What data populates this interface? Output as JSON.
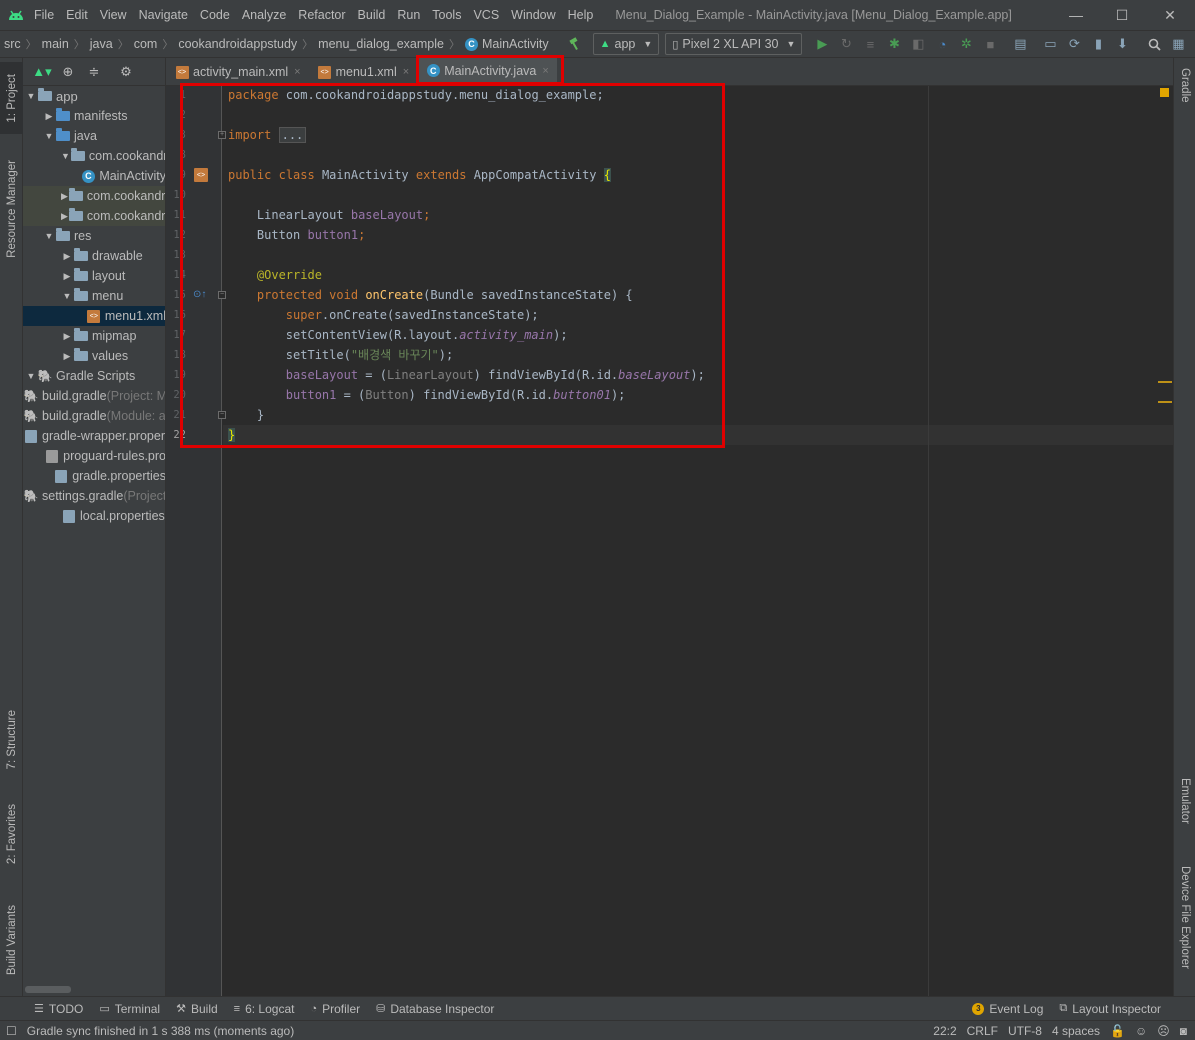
{
  "menubar": {
    "items": [
      "File",
      "Edit",
      "View",
      "Navigate",
      "Code",
      "Analyze",
      "Refactor",
      "Build",
      "Run",
      "Tools",
      "VCS",
      "Window",
      "Help"
    ],
    "window_title": "Menu_Dialog_Example - MainActivity.java [Menu_Dialog_Example.app]",
    "minimize": "—",
    "maximize": "☐",
    "close": "✕"
  },
  "navbar": {
    "breadcrumbs": [
      "src",
      "main",
      "java",
      "com",
      "cookandroidappstudy",
      "menu_dialog_example",
      "MainActivity"
    ],
    "run_config": "app",
    "device": "Pixel 2 XL API 30"
  },
  "left_tabs": [
    "1: Project",
    "Resource Manager",
    "7: Structure",
    "2: Favorites",
    "Build Variants"
  ],
  "right_tabs": [
    "Gradle",
    "Emulator",
    "Device File Explorer"
  ],
  "project_tree": [
    {
      "label": "app",
      "muted": ""
    },
    {
      "label": "manifests",
      "muted": ""
    },
    {
      "label": "java",
      "muted": ""
    },
    {
      "label": "com.cookandroidappstudy.menu_dialog_example",
      "muted": ""
    },
    {
      "label": "MainActivity",
      "muted": ""
    },
    {
      "label": "com.cookandroidappstudy.menu_dialog_example",
      "muted": ""
    },
    {
      "label": "com.cookandroidappstudy.menu_dialog_example",
      "muted": ""
    },
    {
      "label": "res",
      "muted": ""
    },
    {
      "label": "drawable",
      "muted": ""
    },
    {
      "label": "layout",
      "muted": ""
    },
    {
      "label": "menu",
      "muted": ""
    },
    {
      "label": "menu1.xml",
      "muted": ""
    },
    {
      "label": "mipmap",
      "muted": ""
    },
    {
      "label": "values",
      "muted": ""
    },
    {
      "label": "Gradle Scripts",
      "muted": ""
    },
    {
      "label": "build.gradle",
      "muted": " (Project: Menu_Dialog_Example)"
    },
    {
      "label": "build.gradle",
      "muted": " (Module: app)"
    },
    {
      "label": "gradle-wrapper.properties",
      "muted": ""
    },
    {
      "label": "proguard-rules.pro",
      "muted": ""
    },
    {
      "label": "gradle.properties",
      "muted": ""
    },
    {
      "label": "settings.gradle",
      "muted": " (Project Settings)"
    },
    {
      "label": "local.properties",
      "muted": ""
    }
  ],
  "editor_tabs": [
    {
      "label": "activity_main.xml",
      "close": "×"
    },
    {
      "label": "menu1.xml",
      "close": "×"
    },
    {
      "label": "MainActivity.java",
      "close": "×"
    }
  ],
  "line_numbers": [
    "1",
    "2",
    "3",
    "8",
    "9",
    "10",
    "11",
    "12",
    "13",
    "14",
    "15",
    "16",
    "17",
    "18",
    "19",
    "20",
    "21",
    "22"
  ],
  "code": {
    "l1": {
      "kw": "package",
      "rest": " com.cookandroidappstudy.menu_dialog_example;"
    },
    "l3": {
      "kw": "import",
      "folded": "..."
    },
    "l9": {
      "kw1": "public",
      "kw2": "class",
      "name": "MainActivity",
      "kw3": "extends",
      "parent": "AppCompatActivity",
      "brace": "{"
    },
    "l11": {
      "type": "LinearLayout",
      "field": "baseLayout",
      "semi": ";"
    },
    "l12": {
      "type": "Button",
      "field": "button1",
      "semi": ";"
    },
    "l14": {
      "ann": "@Override"
    },
    "l15": {
      "kw1": "protected",
      "kw2": "void",
      "fn": "onCreate",
      "params": "(Bundle savedInstanceState) {"
    },
    "l16": {
      "kw": "super",
      "rest": ".onCreate(savedInstanceState);"
    },
    "l17": {
      "a": "setContentView(R.layout.",
      "it": "activity_main",
      "b": ");"
    },
    "l18": {
      "a": "setTitle(",
      "str": "\"배경색 바꾸기\"",
      "b": ");"
    },
    "l19": {
      "field": "baseLayout",
      "a": " = (",
      "cast": "LinearLayout",
      "b": ") findViewById(R.id.",
      "it": "baseLayout",
      "c": ");"
    },
    "l20": {
      "field": "button1",
      "a": " = (",
      "cast": "Button",
      "b": ") findViewById(R.id.",
      "it": "button01",
      "c": ");"
    },
    "l21": {
      "text": "}"
    },
    "l22": {
      "text": "}"
    }
  },
  "toolwindows": [
    "TODO",
    "Terminal",
    "Build",
    "6: Logcat",
    "Profiler",
    "Database Inspector"
  ],
  "right_toolwindows": {
    "event_count": "3",
    "event_log": "Event Log",
    "layout_inspector": "Layout Inspector"
  },
  "status": {
    "message": "Gradle sync finished in 1 s 388 ms (moments ago)",
    "position": "22:2",
    "line_sep": "CRLF",
    "encoding": "UTF-8",
    "indent": "4 spaces"
  },
  "colors": {
    "highlight_box": "#e00000",
    "accent": "#4a88c7"
  }
}
